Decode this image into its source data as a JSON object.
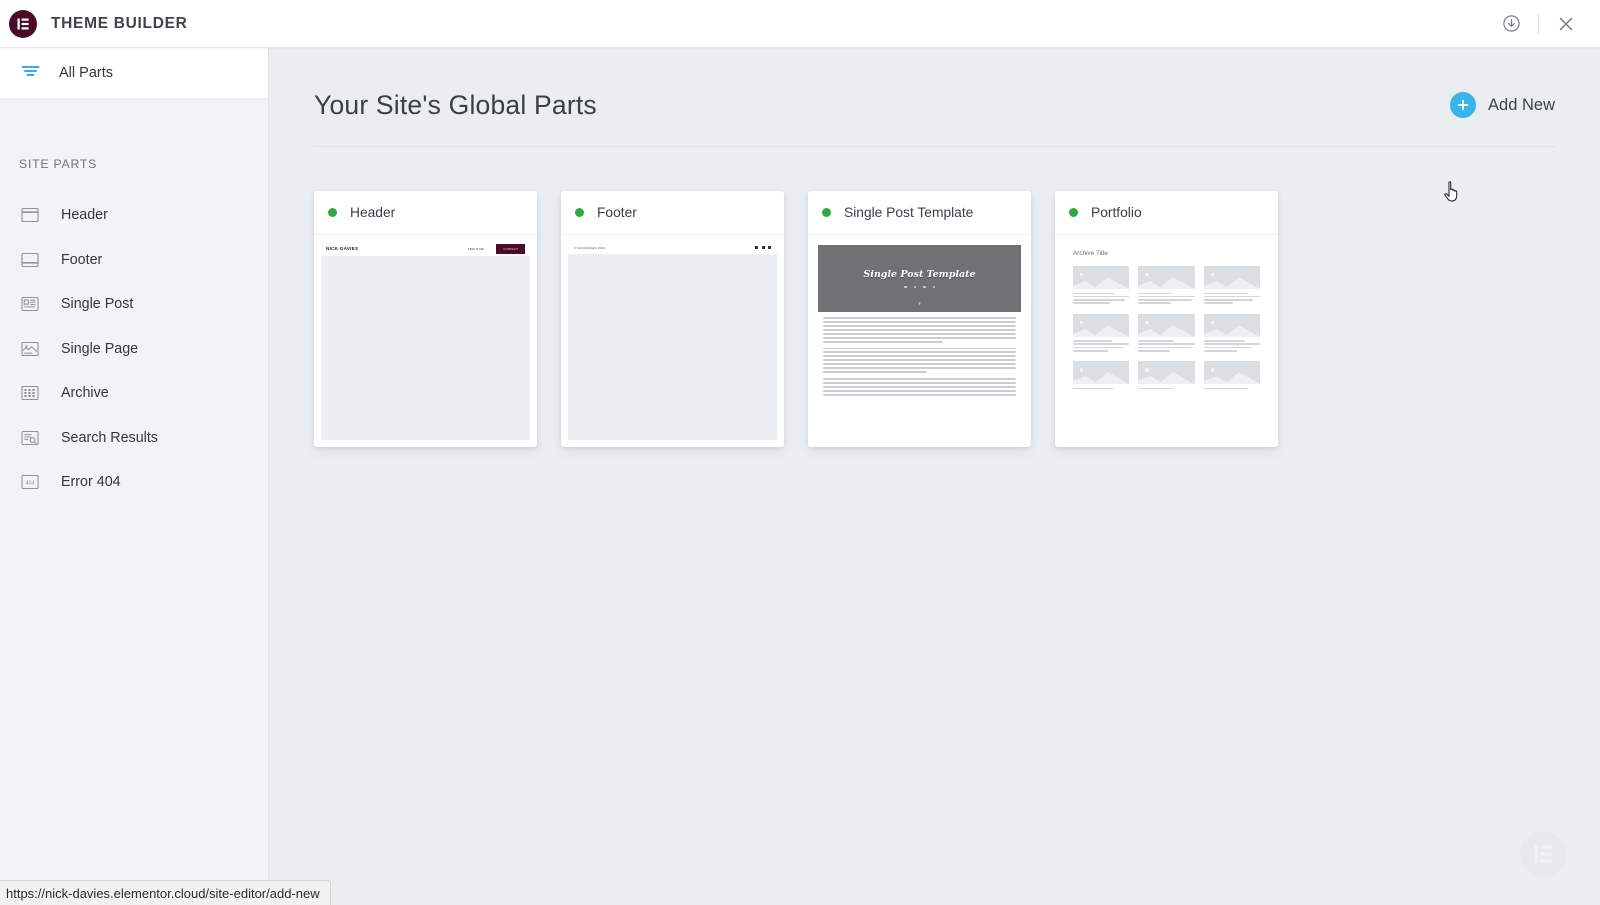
{
  "topbar": {
    "logo_icon": "elementor-logo-icon",
    "title": "THEME BUILDER",
    "save_icon": "download-circle-icon",
    "close_icon": "close-icon"
  },
  "sidebar": {
    "all_parts": {
      "label": "All Parts",
      "icon": "filter-icon"
    },
    "section_label": "SITE PARTS",
    "items": [
      {
        "label": "Header",
        "icon": "header-layout-icon"
      },
      {
        "label": "Footer",
        "icon": "footer-layout-icon"
      },
      {
        "label": "Single Post",
        "icon": "single-post-icon"
      },
      {
        "label": "Single Page",
        "icon": "single-page-icon"
      },
      {
        "label": "Archive",
        "icon": "archive-grid-icon"
      },
      {
        "label": "Search Results",
        "icon": "search-results-icon"
      },
      {
        "label": "Error 404",
        "icon": "error-404-icon"
      }
    ]
  },
  "main": {
    "page_title": "Your Site's Global Parts",
    "add_new": {
      "label": "Add New",
      "icon": "plus-circle-icon"
    }
  },
  "cards": [
    {
      "title": "Header",
      "status": "active",
      "preview_type": "header",
      "preview": {
        "logo": "NICK·DAVIES",
        "nav": "ABOUT ME",
        "button": "CONTACT"
      }
    },
    {
      "title": "Footer",
      "status": "active",
      "preview_type": "footer",
      "preview": {
        "copyright": "© NICKDAVIES 2020",
        "socials": [
          "facebook-icon",
          "twitter-icon",
          "instagram-icon"
        ]
      }
    },
    {
      "title": "Single Post Template",
      "status": "active",
      "preview_type": "single-post",
      "preview": {
        "hero_title": "Single Post Template",
        "scroll_icon": "chevron-down-icon",
        "body_text": "Lorem ipsum dolor sit amet, consectetur adipiscing elit, sed do eiusmod tempor incididunt ut labore et dolore magna aliqua."
      }
    },
    {
      "title": "Portfolio",
      "status": "active",
      "preview_type": "portfolio",
      "preview": {
        "archive_title": "Archive Title",
        "thumb_count": 9
      }
    }
  ],
  "watermark": {
    "icon": "elementor-watermark-icon"
  },
  "status_url": "https://nick-davies.elementor.cloud/site-editor/add-new",
  "colors": {
    "brand_maroon": "#4b0d26",
    "accent_blue": "#39b3ea",
    "status_green": "#2fa93f",
    "canvas": "#eaeef0"
  }
}
